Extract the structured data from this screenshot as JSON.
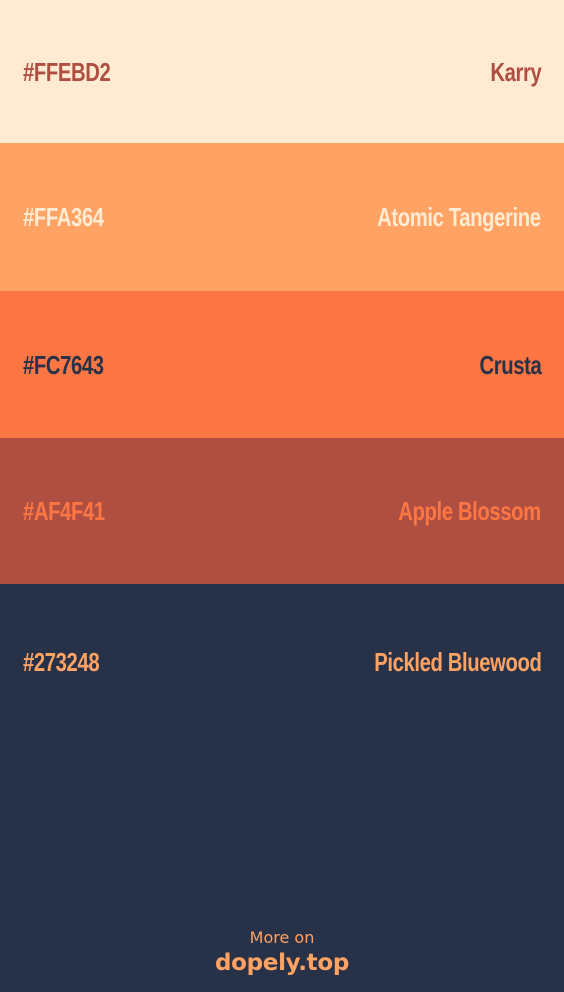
{
  "swatches": [
    {
      "hex": "#FFEBD2",
      "name": "Karry",
      "background": "#FFEBD2",
      "text_color": "#AF4F41"
    },
    {
      "hex": "#FFA364",
      "name": "Atomic Tangerine",
      "background": "#FFA364",
      "text_color": "#FFEBD2"
    },
    {
      "hex": "#FC7643",
      "name": "Crusta",
      "background": "#FC7643",
      "text_color": "#273248"
    },
    {
      "hex": "#AF4F41",
      "name": "Apple Blossom",
      "background": "#AF4F41",
      "text_color": "#FC7643"
    },
    {
      "hex": "#273248",
      "name": "Pickled Bluewood",
      "background": "#273248",
      "text_color": "#FFA364"
    }
  ],
  "footer": {
    "more_on": "More on",
    "brand": "dopely.top",
    "more_color": "#FFA364",
    "brand_color": "#FFA364"
  }
}
